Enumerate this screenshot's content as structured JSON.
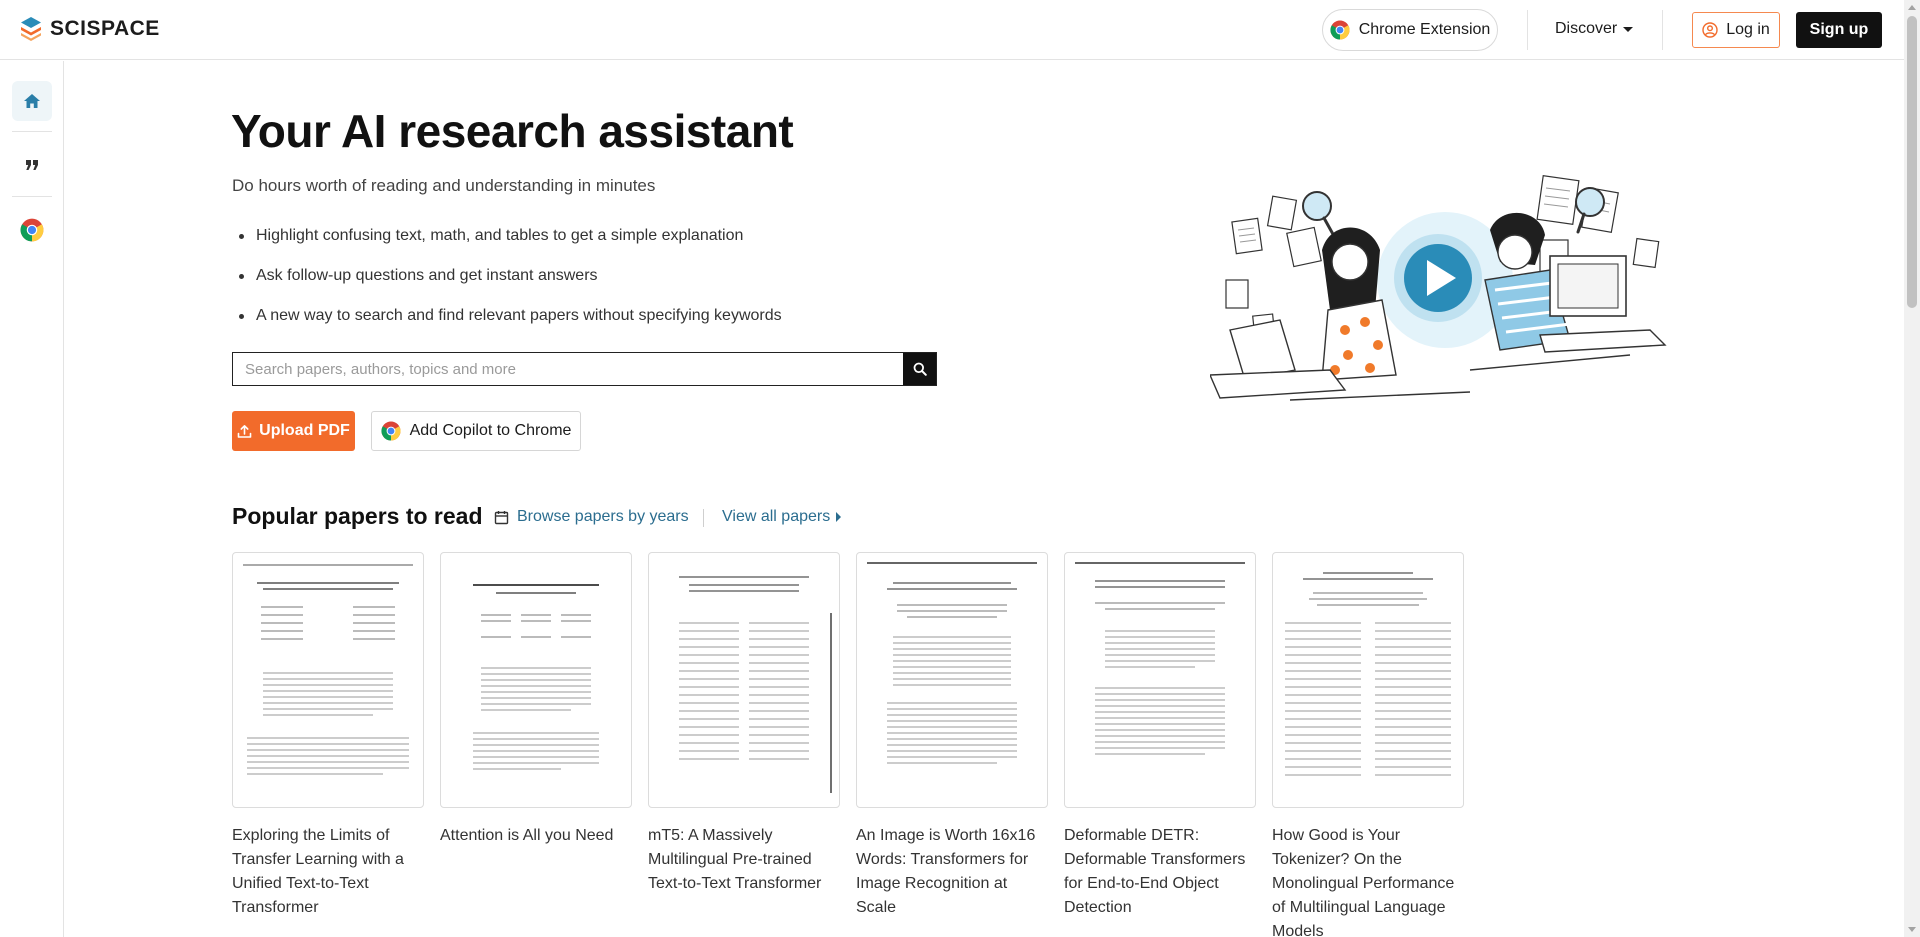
{
  "header": {
    "logo_text": "SCISPACE",
    "chrome_extension_label": "Chrome Extension",
    "discover_label": "Discover",
    "login_label": "Log in",
    "signup_label": "Sign up"
  },
  "sidebar": {
    "items": [
      {
        "name": "home",
        "icon": "home-icon",
        "active": true
      },
      {
        "name": "citation",
        "icon": "quote-icon",
        "active": false
      },
      {
        "name": "chrome",
        "icon": "chrome-icon",
        "active": false
      }
    ]
  },
  "hero": {
    "title": "Your AI research assistant",
    "subtitle": "Do hours worth of reading and understanding in minutes",
    "bullets": [
      "Highlight confusing text, math, and tables to get a simple explanation",
      "Ask follow-up questions and get instant answers",
      "A new way to search and find relevant papers without specifying keywords"
    ],
    "search_placeholder": "Search papers, authors, topics and more",
    "upload_label": "Upload PDF",
    "copilot_label": "Add Copilot to Chrome"
  },
  "popular": {
    "title": "Popular papers to read",
    "browse_label": "Browse papers by years",
    "view_all_label": "View all papers",
    "papers": [
      {
        "title": "Exploring the Limits of Transfer Learning with a Unified Text-to-Text Transformer"
      },
      {
        "title": "Attention is All you Need"
      },
      {
        "title": "mT5: A Massively Multilingual Pre-trained Text-to-Text Transformer"
      },
      {
        "title": "An Image is Worth 16x16 Words: Transformers for Image Recognition at Scale"
      },
      {
        "title": "Deformable DETR: Deformable Transformers for End-to-End Object Detection"
      },
      {
        "title": "How Good is Your Tokenizer? On the Monolingual Performance of Multilingual Language Models"
      }
    ]
  },
  "colors": {
    "accent_orange": "#f26b2b",
    "link_blue": "#2b6d8f",
    "play_blue": "#2a8cb8"
  }
}
